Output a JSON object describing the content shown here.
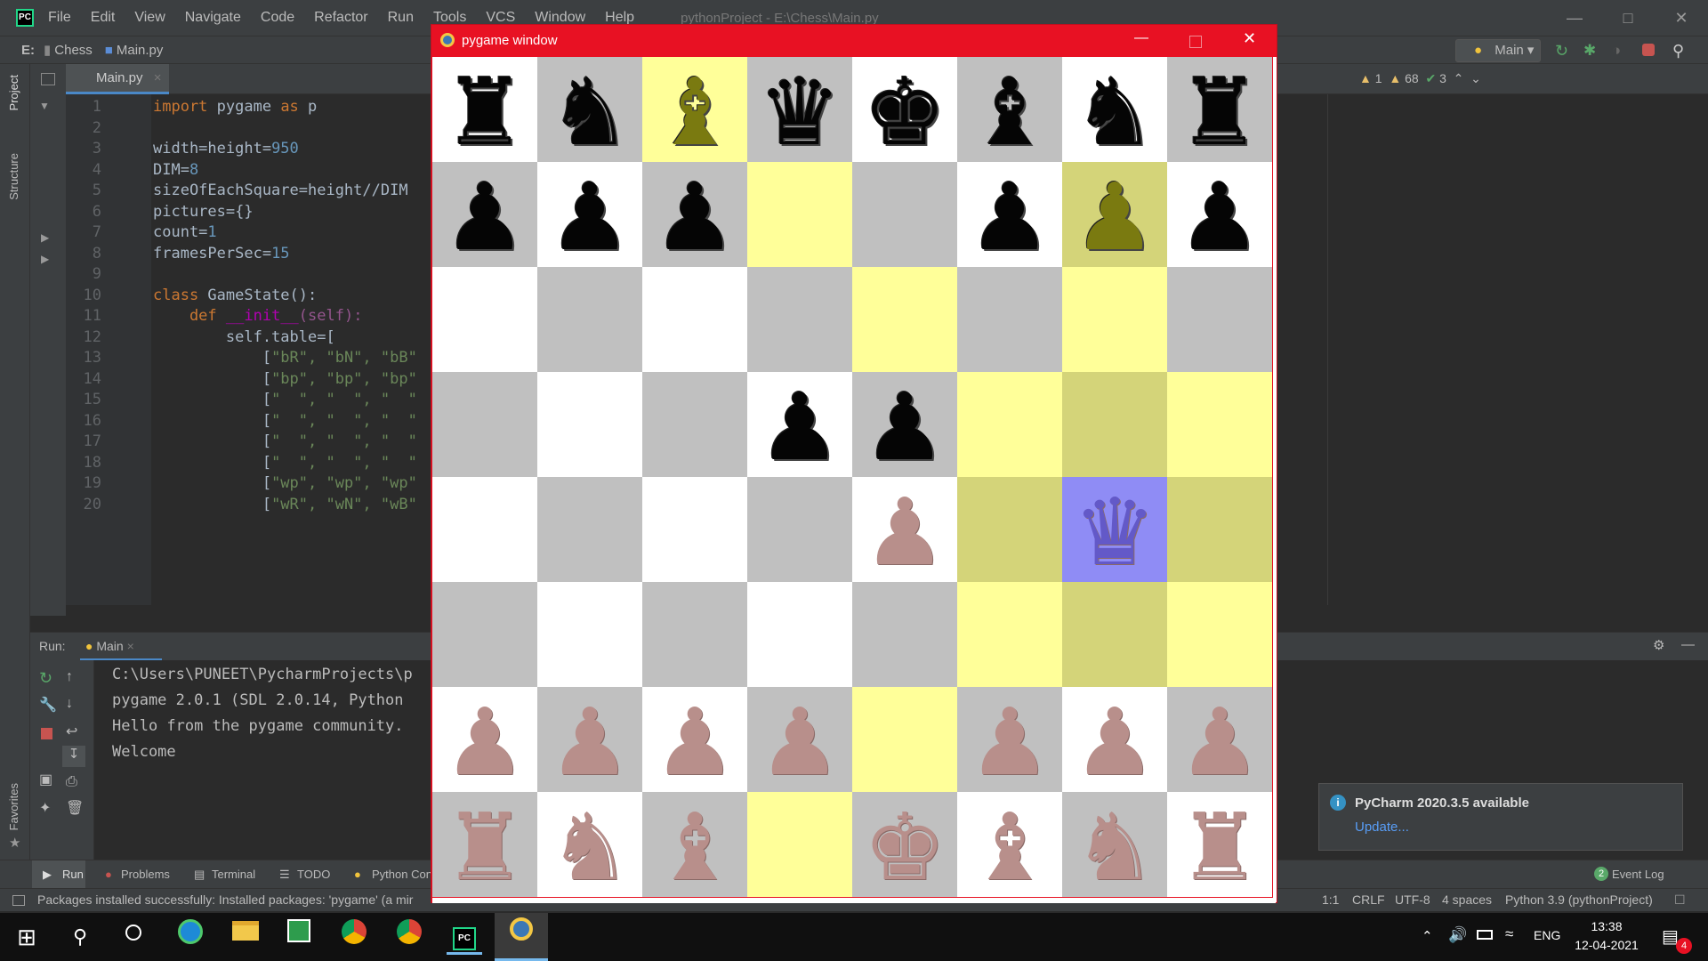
{
  "ide": {
    "menu": [
      "File",
      "Edit",
      "View",
      "Navigate",
      "Code",
      "Refactor",
      "Run",
      "Tools",
      "VCS",
      "Window",
      "Help"
    ],
    "title": "pythonProject - E:\\Chess\\Main.py",
    "nav": {
      "drive": "E:",
      "folder": "Chess",
      "file": "Main.py"
    },
    "run_config": "Main",
    "editor_tab": "Main.py",
    "inspection": {
      "warn1": "1",
      "warn2": "68",
      "ok": "3"
    },
    "left_tabs": {
      "project": "Project",
      "structure": "Structure",
      "favorites": "Favorites"
    },
    "line_numbers": [
      "1",
      "2",
      "3",
      "4",
      "5",
      "6",
      "7",
      "8",
      "9",
      "10",
      "11",
      "12",
      "13",
      "14",
      "15",
      "16",
      "17",
      "18",
      "19",
      "20"
    ],
    "code": [
      {
        "a": "import",
        "b": " pygame ",
        "c": "as",
        "d": " p"
      },
      {
        "a": "",
        "b": "",
        "c": "",
        "d": ""
      },
      {
        "a": "",
        "b": "width=height=",
        "c": "",
        "d": "950"
      },
      {
        "a": "",
        "b": "DIM=",
        "c": "",
        "d": "8"
      },
      {
        "a": "",
        "b": "sizeOfEachSquare=height//DIM",
        "c": "",
        "d": ""
      },
      {
        "a": "",
        "b": "pictures={}",
        "c": "",
        "d": ""
      },
      {
        "a": "",
        "b": "count=",
        "c": "",
        "d": "1"
      },
      {
        "a": "",
        "b": "framesPerSec=",
        "c": "",
        "d": "15"
      },
      {
        "a": "",
        "b": "",
        "c": "",
        "d": ""
      },
      {
        "a": "class",
        "b": " GameState():",
        "c": "",
        "d": ""
      },
      {
        "a": "    def",
        "b": " ",
        "c": "__init__",
        "d": "(self):"
      },
      {
        "a": "",
        "b": "        self.table=[",
        "c": "",
        "d": ""
      },
      {
        "a": "",
        "b": "            [",
        "c": "\"bR\", \"bN\", \"bB\"",
        "d": ""
      },
      {
        "a": "",
        "b": "            [",
        "c": "\"bp\", \"bp\", \"bp\"",
        "d": ""
      },
      {
        "a": "",
        "b": "            [",
        "c": "\"  \", \"  \", \"  \"",
        "d": ""
      },
      {
        "a": "",
        "b": "            [",
        "c": "\"  \", \"  \", \"  \"",
        "d": ""
      },
      {
        "a": "",
        "b": "            [",
        "c": "\"  \", \"  \", \"  \"",
        "d": ""
      },
      {
        "a": "",
        "b": "            [",
        "c": "\"  \", \"  \", \"  \"",
        "d": ""
      },
      {
        "a": "",
        "b": "            [",
        "c": "\"wp\", \"wp\", \"wp\"",
        "d": ""
      },
      {
        "a": "",
        "b": "            [",
        "c": "\"wR\", \"wN\", \"wB\"",
        "d": ""
      }
    ],
    "run": {
      "label": "Run:",
      "tab": "Main",
      "output": [
        "C:\\Users\\PUNEET\\PycharmProjects\\p",
        "pygame 2.0.1 (SDL 2.0.14, Python",
        "Hello from the pygame community.",
        "Welcome"
      ]
    },
    "bottom_tabs": [
      "Run",
      "Problems",
      "Terminal",
      "TODO",
      "Python Con"
    ],
    "event_log": "Event Log",
    "event_count": "2",
    "status": {
      "message": "Packages installed successfully: Installed packages: 'pygame' (a mir",
      "pos": "1:1",
      "eol": "CRLF",
      "enc": "UTF-8",
      "indent": "4 spaces",
      "interp": "Python 3.9 (pythonProject)"
    },
    "notification": {
      "title": "PyCharm 2020.3.5 available",
      "link": "Update..."
    }
  },
  "pygame": {
    "title": "pygame window",
    "colors": {
      "light": "#ffffff",
      "dark": "#c0c0c0",
      "hl_light": "#ffff99",
      "hl_dark": "#d4d479",
      "selected": "#8f8cf5"
    },
    "board": [
      [
        "bR",
        "bN",
        "bB*",
        "bQ",
        "bK",
        "bB",
        "bN",
        "bR"
      ],
      [
        "bp",
        "bp",
        "bp",
        "",
        "",
        "bp",
        "bp*",
        "bp"
      ],
      [
        "",
        "",
        "",
        "",
        "",
        "",
        "",
        ""
      ],
      [
        "",
        "",
        "",
        "bp",
        "bp",
        "",
        "",
        ""
      ],
      [
        "",
        "",
        "",
        "",
        "wp",
        "",
        "wQ",
        ""
      ],
      [
        "",
        "",
        "",
        "",
        "",
        "",
        "",
        ""
      ],
      [
        "wp",
        "wp",
        "wp",
        "wp",
        "",
        "wp",
        "wp",
        "wp"
      ],
      [
        "wR",
        "wN",
        "wB",
        "",
        "wK",
        "wB",
        "wN",
        "wR"
      ]
    ],
    "highlights": [
      [
        0,
        2
      ],
      [
        1,
        3
      ],
      [
        1,
        6
      ],
      [
        2,
        4
      ],
      [
        2,
        6
      ],
      [
        3,
        5
      ],
      [
        3,
        6
      ],
      [
        3,
        7
      ],
      [
        4,
        5
      ],
      [
        4,
        7
      ],
      [
        5,
        5
      ],
      [
        5,
        6
      ],
      [
        5,
        7
      ],
      [
        6,
        4
      ],
      [
        7,
        3
      ]
    ],
    "selected": [
      4,
      6
    ]
  },
  "taskbar": {
    "time": "13:38",
    "date": "12-04-2021",
    "lang": "ENG",
    "badge": "4"
  }
}
